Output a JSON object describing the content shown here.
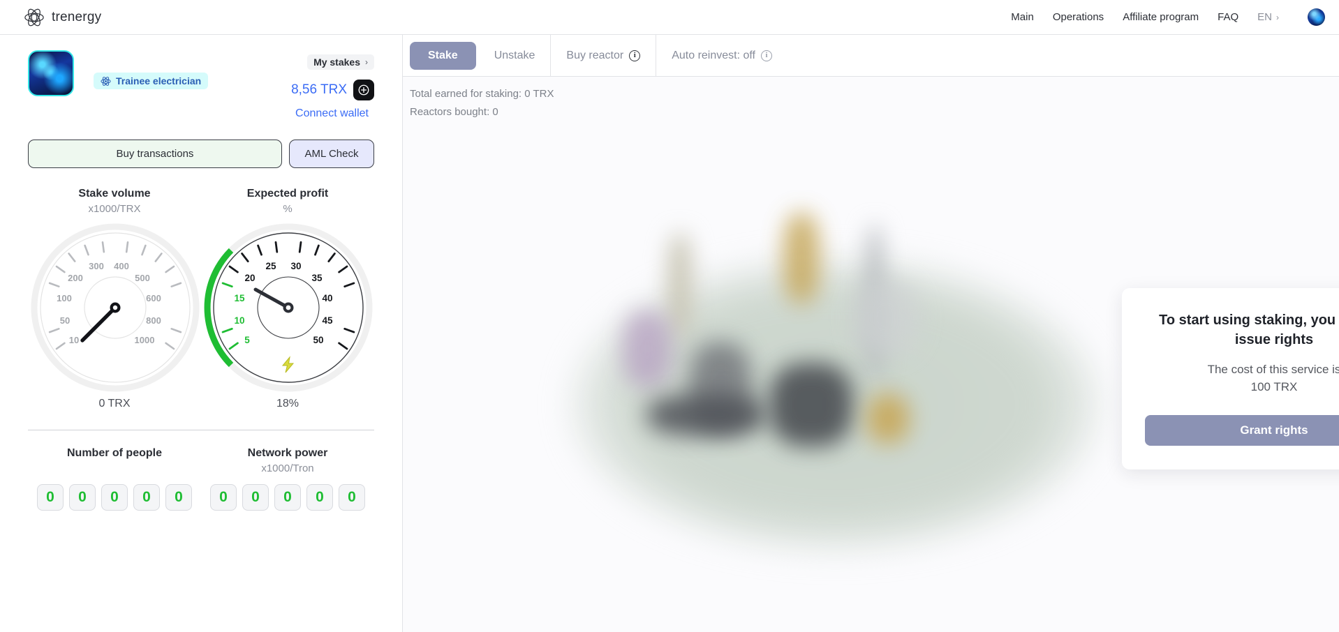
{
  "header": {
    "brand": "trenergy",
    "brand_icon": "atom-logo-icon",
    "nav": [
      {
        "label": "Main"
      },
      {
        "label": "Operations"
      },
      {
        "label": "Affiliate program"
      },
      {
        "label": "FAQ"
      }
    ],
    "language": "EN",
    "language_chevron": "›",
    "avatar_icon": "user-avatar-icon"
  },
  "sidebar": {
    "avatar_icon": "profile-avatar-icon",
    "rank_badge": "Trainee electrician",
    "rank_icon": "atom-icon",
    "my_stakes_label": "My stakes",
    "my_stakes_chevron": "›",
    "balance": "8,56 TRX",
    "add_icon": "plus-circle-icon",
    "connect_wallet": "Connect wallet",
    "buy_transactions": "Buy transactions",
    "aml_check": "AML Check"
  },
  "gauges": [
    {
      "title": "Stake volume",
      "subtitle": "x1000/TRX",
      "value_text": "0 TRX",
      "labels": [
        "10",
        "50",
        "100",
        "200",
        "300",
        "400",
        "500",
        "600",
        "800",
        "1000"
      ],
      "needle_value": 0,
      "accent": "#1fbd33",
      "highlight_count": 0
    },
    {
      "title": "Expected profit",
      "subtitle": "%",
      "value_text": "18%",
      "labels": [
        "5",
        "10",
        "15",
        "20",
        "25",
        "30",
        "35",
        "40",
        "45",
        "50"
      ],
      "needle_value": 18,
      "accent": "#1fbd33",
      "highlight_count": 3,
      "bolt_icon": "lightning-bolt-icon"
    }
  ],
  "counters": [
    {
      "title": "Number of people",
      "subtitle": "",
      "digits": [
        "0",
        "0",
        "0",
        "0",
        "0"
      ]
    },
    {
      "title": "Network power",
      "subtitle": "x1000/Tron",
      "digits": [
        "0",
        "0",
        "0",
        "0",
        "0"
      ]
    }
  ],
  "main": {
    "tabs": [
      {
        "label": "Stake",
        "active": true,
        "info": false
      },
      {
        "label": "Unstake",
        "active": false,
        "info": false
      },
      {
        "label": "Buy reactor",
        "active": false,
        "info": true
      },
      {
        "label": "Auto reinvest: off",
        "active": false,
        "info": true
      }
    ],
    "stats": [
      "Total earned for staking: 0 TRX",
      "Reactors bought: 0"
    ]
  },
  "modal": {
    "title": "To start using staking, you need to issue rights",
    "subtitle": "The cost of this service is\n100 TRX",
    "button": "Grant rights"
  },
  "colors": {
    "accent_green": "#1fbd33",
    "link_blue": "#3b6cf5",
    "muted": "#8b8f99",
    "primary_button": "#8b92b4",
    "badge_bg": "#d5fbfb"
  },
  "chart_data": [
    {
      "type": "gauge",
      "title": "Stake volume",
      "subtitle": "x1000/TRX",
      "unit": "TRX",
      "tick_labels": [
        "10",
        "50",
        "100",
        "200",
        "300",
        "400",
        "500",
        "600",
        "800",
        "1000"
      ],
      "scale_min": 0,
      "scale_max": 1000,
      "current_value": 0,
      "current_value_text": "0 TRX",
      "needle_angle_deg": 228,
      "highlight_arc": false,
      "grid": false,
      "legend": "none"
    },
    {
      "type": "gauge",
      "title": "Expected profit",
      "subtitle": "%",
      "unit": "%",
      "tick_labels": [
        "5",
        "10",
        "15",
        "20",
        "25",
        "30",
        "35",
        "40",
        "45",
        "50"
      ],
      "scale_min": 0,
      "scale_max": 50,
      "current_value": 18,
      "current_value_text": "18%",
      "needle_angle_deg": 212,
      "highlight_arc": true,
      "highlight_range": [
        0,
        17
      ],
      "highlight_color": "#1fbd33",
      "grid": false,
      "legend": "none",
      "annotation_icon": "lightning-bolt-icon"
    }
  ]
}
